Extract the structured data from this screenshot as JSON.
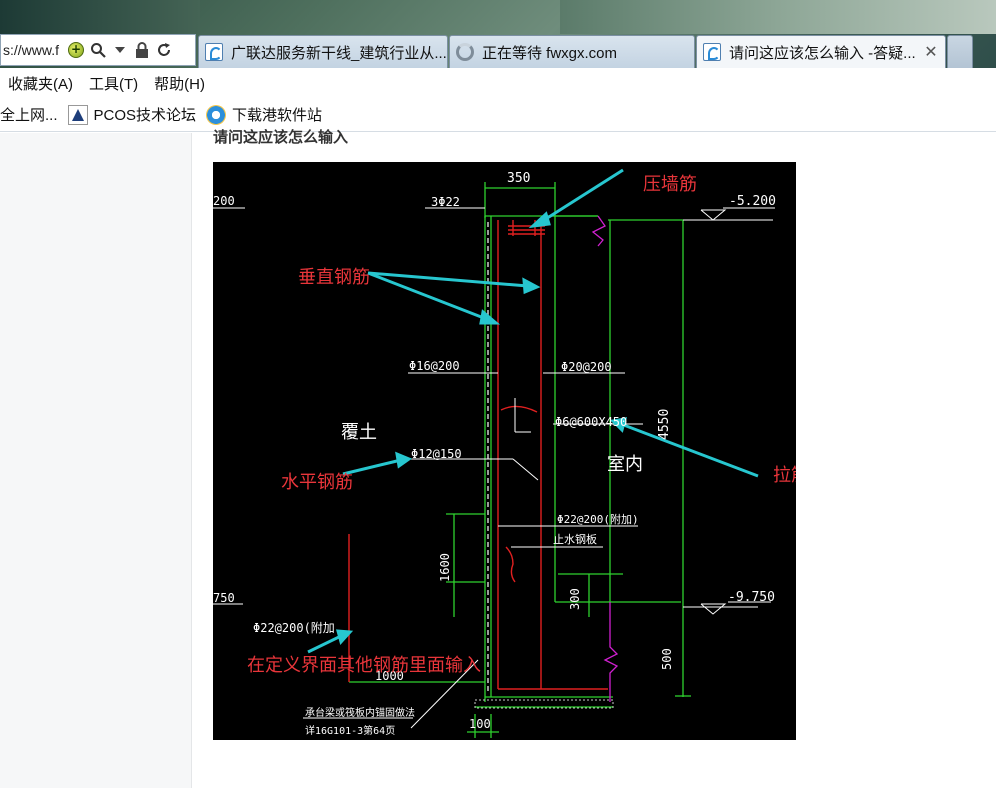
{
  "browser": {
    "address_url": "s://www.f",
    "tabs": [
      {
        "title": "广联达服务新干线_建筑行业从..."
      },
      {
        "title": "正在等待 fwxgx.com"
      },
      {
        "title": "请问这应该怎么输入 -答疑...",
        "close": "✕"
      }
    ],
    "menu": [
      "收藏夹(A)",
      "工具(T)",
      "帮助(H)"
    ],
    "favorites": [
      "全上网...",
      "PCOS技术论坛",
      "下载港软件站"
    ],
    "icons": [
      "compatibility-icon",
      "search-icon",
      "dropdown-icon",
      "lock-icon",
      "refresh-icon",
      "close-icon"
    ]
  },
  "page": {
    "question_title": "请问这应该怎么输入"
  },
  "drawing": {
    "dims": {
      "top_width": "350",
      "top_bar": "3Φ22",
      "left_elev_top": "200",
      "left_elev_bottom": "750",
      "right_elev_top": "-5.200",
      "right_elev_bottom": "-9.750",
      "height_total": "4550",
      "h1600": "1600",
      "h300": "300",
      "h500": "500",
      "w1000": "1000",
      "w100": "100"
    },
    "labels": {
      "left_vertical": "Φ16@200",
      "right_vertical": "Φ20@200",
      "tie": "Φ6@600X450",
      "horizontal": "Φ12@150",
      "extra_bar": "Φ22@200(附加)",
      "extra_bar_left": "Φ22@200(附加",
      "waterstop": "止水钢板",
      "soil": "覆土",
      "indoor": "室内",
      "note_line1": "承台梁或筏板内锚固做法",
      "note_line2": "详16G101-3第64页"
    },
    "annotations": {
      "pressure_bar": "压墙筋",
      "vertical_bar": "垂直钢筋",
      "horizontal_bar": "水平钢筋",
      "tie_bar": "拉筋",
      "other_bar": "在定义界面其他钢筋里面输入"
    },
    "colors": {
      "background": "#000000",
      "green": "#2fd12f",
      "red": "#e02020",
      "magenta": "#d020d0",
      "cyan_arrow": "#27c6cf",
      "annotation_red": "#e8353a"
    }
  }
}
